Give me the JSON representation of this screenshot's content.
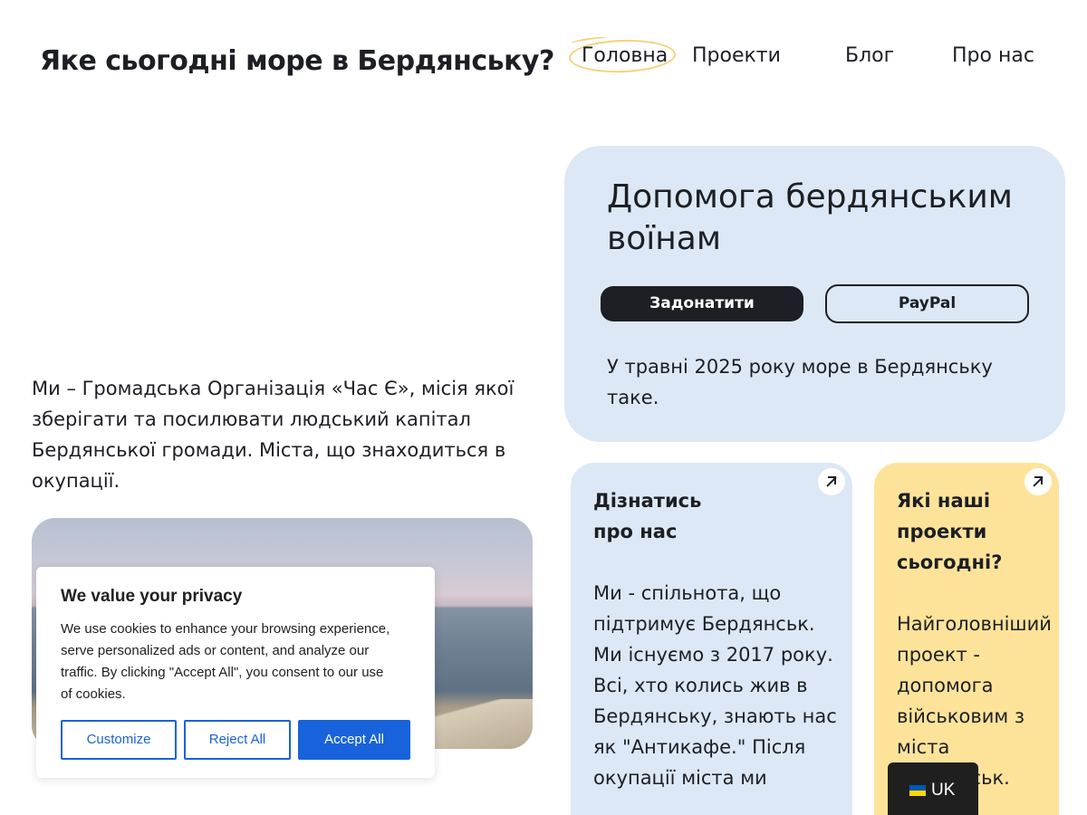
{
  "header": {
    "site_title": "Яке сьогодні море в Бердянську?",
    "nav": [
      {
        "label": "Головна",
        "active": true
      },
      {
        "label": "Проекти"
      },
      {
        "label": "Блог"
      },
      {
        "label": "Про нас"
      }
    ],
    "active_highlight_color": "#f3d27a"
  },
  "intro": {
    "text": "Ми – Громадська Організація «Час Є», місія якої зберігати та посилювати людський капітал Бердянської громади. Міста, що знаходиться в окупації."
  },
  "help_card": {
    "title": "Допомога бердянським воїнам",
    "donate_label": "Задонатити",
    "paypal_label": "PayPal",
    "text": "У травні 2025 року море в Бердянську таке.",
    "background": "#dce8f6"
  },
  "cards": {
    "about": {
      "title_line1": "Дізнатись",
      "title_line2": "про нас",
      "text": "Ми - спільнота, що підтримує Бердянськ. Ми існуємо з 2017 року. Всі, хто колись жив в Бердянську, знають нас як \"Антикафе.\" Після окупації міста ми",
      "icon": "arrow-up-right-icon"
    },
    "projects": {
      "title": "Які наші проекти сьогодні?",
      "text": "Найголовніший проект - допомога військовим з міста Бердянськ.",
      "icon": "arrow-up-right-icon",
      "background": "#fde39a"
    }
  },
  "cookie_banner": {
    "title": "We value your privacy",
    "text": "We use cookies to enhance your browsing experience, serve personalized ads or content, and analyze our traffic. By clicking \"Accept All\", you consent to our use of cookies.",
    "customize_label": "Customize",
    "reject_label": "Reject All",
    "accept_label": "Accept All",
    "accent_color": "#1863dc"
  },
  "language_switcher": {
    "label": "UK",
    "icon": "ukraine-flag-icon"
  }
}
